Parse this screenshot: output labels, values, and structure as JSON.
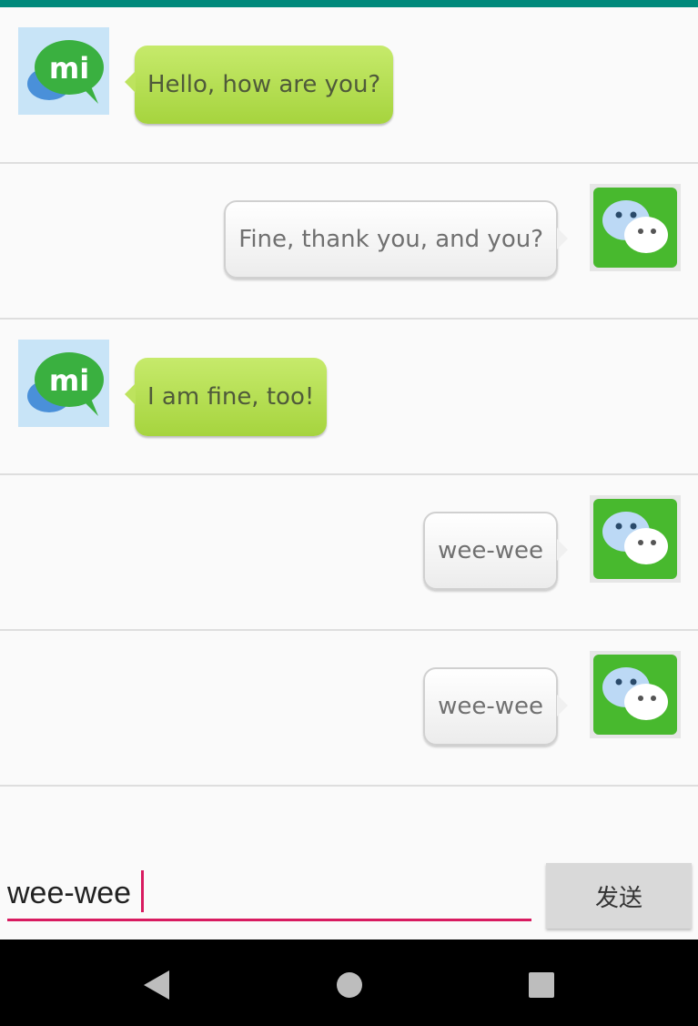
{
  "colors": {
    "accent": "#00897b",
    "input_underline": "#d81b60",
    "bubble_received": "#b4de53",
    "bubble_sent": "#f5f5f5"
  },
  "messages": [
    {
      "side": "left",
      "avatar_icon": "mi-chat-icon",
      "text": "Hello, how are you?"
    },
    {
      "side": "right",
      "avatar_icon": "wechat-icon",
      "text": "Fine, thank you, and you?"
    },
    {
      "side": "left",
      "avatar_icon": "mi-chat-icon",
      "text": "I am fine, too!"
    },
    {
      "side": "right",
      "avatar_icon": "wechat-icon",
      "text": "wee-wee"
    },
    {
      "side": "right",
      "avatar_icon": "wechat-icon",
      "text": "wee-wee"
    }
  ],
  "composer": {
    "input_value": "wee-wee",
    "send_label": "发送"
  },
  "nav_icons": [
    "back-icon",
    "home-icon",
    "recent-apps-icon"
  ]
}
